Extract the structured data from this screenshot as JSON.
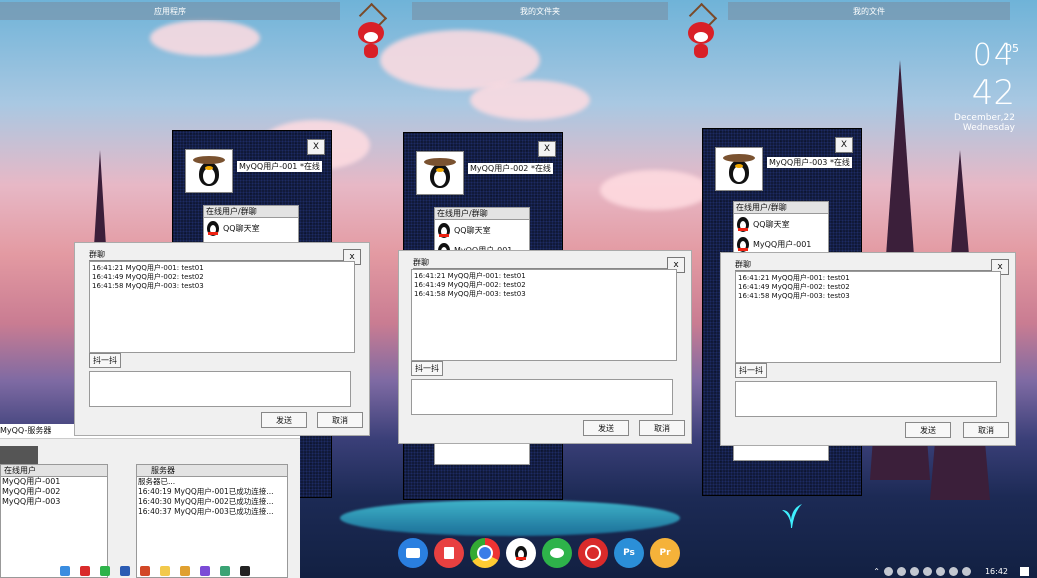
{
  "desktop": {
    "top_items": [
      "应用程序",
      "我的文件夹",
      "我的文件"
    ],
    "clock": {
      "hour": "04",
      "second": "05",
      "minute": "42",
      "date": "December,22",
      "weekday": "Wednesday"
    }
  },
  "clients": [
    {
      "user": "MyQQ用户-001",
      "status": "*在线",
      "list_header": "在线用户/群聊",
      "list_items": [
        "QQ聊天室"
      ]
    },
    {
      "user": "MyQQ用户-002",
      "status": "*在线",
      "list_header": "在线用户/群聊",
      "list_items": [
        "QQ聊天室",
        "MyQQ用户-001"
      ]
    },
    {
      "user": "MyQQ用户-003",
      "status": "*在线",
      "list_header": "在线用户/群聊",
      "list_items": [
        "QQ聊天室",
        "MyQQ用户-001"
      ]
    }
  ],
  "close_label": "x",
  "client_close_label": "X",
  "chat": {
    "title": "群聊",
    "messages": [
      "16:41:21 MyQQ用户-001: test01",
      "16:41:49 MyQQ用户-002: test02",
      "16:41:58 MyQQ用户-003: test03"
    ],
    "shake_label": "抖一抖",
    "send_label": "发送",
    "cancel_label": "取消"
  },
  "server": {
    "title": "MyQQ-服务器",
    "online_header": "在线用户",
    "online_users": [
      "MyQQ用户-001",
      "MyQQ用户-002",
      "MyQQ用户-003"
    ],
    "log_header": "服务器",
    "log": [
      "服务器已...",
      "16:40:19 MyQQ用户-001已成功连接...",
      "16:40:30 MyQQ用户-002已成功连接...",
      "16:40:37 MyQQ用户-003已成功连接..."
    ]
  },
  "dock": [
    {
      "name": "message-app-icon",
      "label": "",
      "color": "#2a7fe0"
    },
    {
      "name": "trash-icon",
      "label": "",
      "color": "#e84040"
    },
    {
      "name": "chrome-icon",
      "label": "",
      "color": "#f0f0f0"
    },
    {
      "name": "qq-icon",
      "label": "",
      "color": "#ffffff"
    },
    {
      "name": "wechat-icon",
      "label": "",
      "color": "#2eb34a"
    },
    {
      "name": "netease-music-icon",
      "label": "",
      "color": "#d92b2b"
    },
    {
      "name": "photoshop-icon",
      "label": "Ps",
      "color": "#2b8fd8"
    },
    {
      "name": "premiere-icon",
      "label": "Pr",
      "color": "#f5b23a"
    }
  ],
  "tray": {
    "time": "16:42"
  }
}
